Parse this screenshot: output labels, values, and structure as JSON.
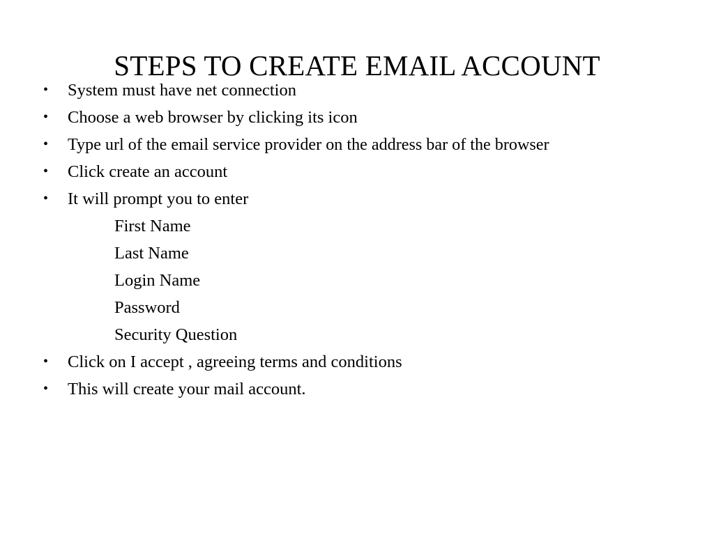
{
  "slide": {
    "title": "STEPS TO CREATE EMAIL ACCOUNT",
    "background_color": "#ffffff",
    "text_color": "#000000",
    "bullet_glyph": "•",
    "lines": [
      {
        "level": 1,
        "text": "System must have net connection"
      },
      {
        "level": 1,
        "text": "Choose a web browser by clicking its icon"
      },
      {
        "level": 1,
        "text": "Type url of the email service provider on the address bar of the browser"
      },
      {
        "level": 1,
        "text": "Click create an account"
      },
      {
        "level": 1,
        "text": "It will prompt you to enter"
      },
      {
        "level": 2,
        "text": "First Name"
      },
      {
        "level": 2,
        "text": "Last Name"
      },
      {
        "level": 2,
        "text": "Login Name"
      },
      {
        "level": 2,
        "text": "Password"
      },
      {
        "level": 2,
        "text": "Security Question"
      },
      {
        "level": 1,
        "text": "Click on I accept , agreeing terms and conditions"
      },
      {
        "level": 1,
        "text": "This will create your mail account."
      }
    ]
  }
}
